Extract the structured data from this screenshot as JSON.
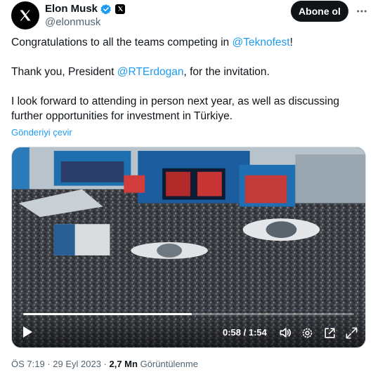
{
  "author": {
    "display_name": "Elon Musk",
    "handle": "@elonmusk",
    "avatar_icon": "x-logo-icon",
    "verified_badge": "verified-badge-icon",
    "affiliation_icon": "x-affiliation-icon"
  },
  "follow_button": {
    "label": "Abone ol"
  },
  "tweet": {
    "line1_prefix": "Congratulations to all the teams competing in ",
    "line1_mention": "@Teknofest",
    "line1_suffix": "!",
    "line2_prefix": "Thank you, President ",
    "line2_mention": "@RTErdogan",
    "line2_suffix": ", for the invitation.",
    "line3": "I look forward to attending in person next year, as well as discussing further opportunities for investment in Türkiye."
  },
  "translate_link": "Gönderiyi çevir",
  "video": {
    "current_time": "0:58",
    "separator": " / ",
    "duration": "1:54",
    "progress_fraction": 0.509
  },
  "meta": {
    "time": "ÖS 7:19",
    "dot1": " · ",
    "date": "29 Eyl 2023",
    "dot2": " · ",
    "views_count": "2,7 Mn",
    "views_label": " Görüntülenme"
  },
  "colors": {
    "accent": "#1d9bf0",
    "verified": "#1d9bf0",
    "text_primary": "#0f1419",
    "text_secondary": "#536471",
    "button_bg": "#0f1419"
  }
}
